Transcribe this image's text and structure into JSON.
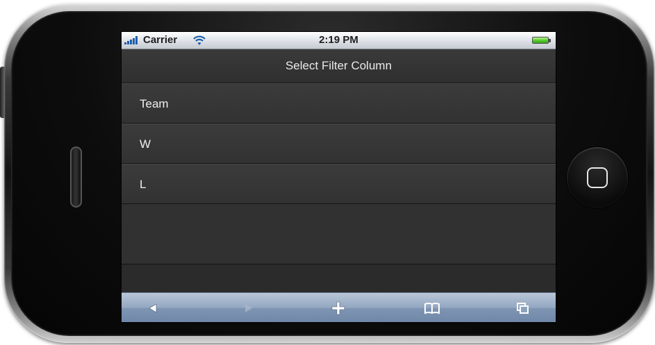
{
  "status_bar": {
    "carrier": "Carrier",
    "time": "2:19 PM"
  },
  "header": {
    "title": "Select Filter Column"
  },
  "filter_columns": [
    {
      "label": "Team"
    },
    {
      "label": "W"
    },
    {
      "label": "L"
    }
  ],
  "toolbar": {
    "buttons": [
      {
        "icon": "back-arrow-icon",
        "enabled": true
      },
      {
        "icon": "forward-arrow-icon",
        "enabled": false
      },
      {
        "icon": "plus-icon",
        "enabled": true
      },
      {
        "icon": "bookmarks-icon",
        "enabled": true
      },
      {
        "icon": "pages-icon",
        "enabled": true
      }
    ]
  },
  "colors": {
    "screen_background": "#303030",
    "list_text": "#f0f0f0",
    "toolbar_blue": "#8ea2bd",
    "signal_blue": "#1c5eaa",
    "battery_green": "#4fc728"
  }
}
